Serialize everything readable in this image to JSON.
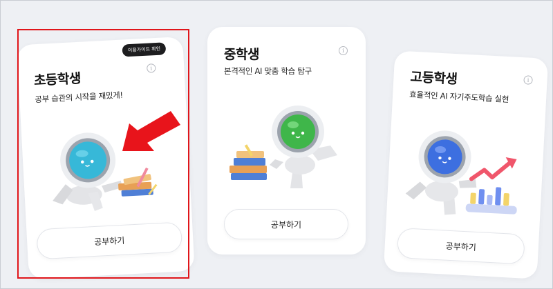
{
  "cards": [
    {
      "title": "초등학생",
      "description": "공부 습관의 시작을 재밌게!",
      "guide_label": "이용가이드 확인",
      "button_label": "공부하기",
      "screen_color": "#37b8d8"
    },
    {
      "title": "중학생",
      "description": "본격적인 AI 맞춤 학습 탐구",
      "button_label": "공부하기",
      "screen_color": "#3fb64a"
    },
    {
      "title": "고등학생",
      "description": "효율적인 AI 자기주도학습 실현",
      "button_label": "공부하기",
      "screen_color": "#3d6fe0"
    }
  ],
  "info_icon_glyph": "i",
  "colors": {
    "background": "#eef0f4",
    "highlight_border": "#e0151a",
    "arrow": "#e8141b"
  }
}
